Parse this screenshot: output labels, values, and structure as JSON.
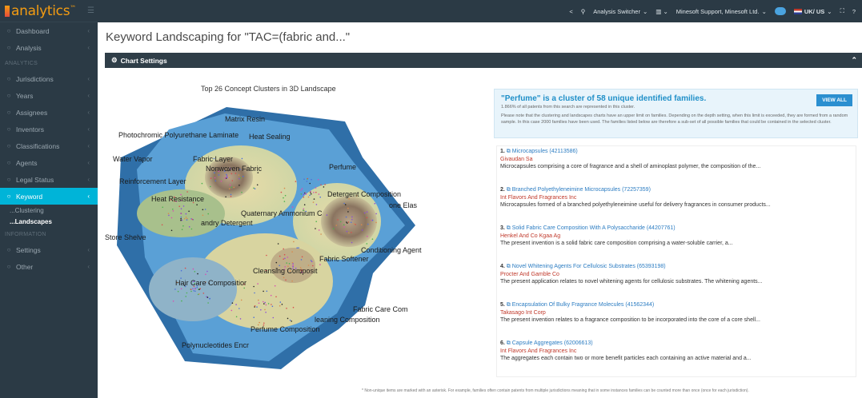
{
  "app": {
    "logo": "analytics",
    "logo_sup": "™"
  },
  "topbar": {
    "analysis_switcher": "Analysis Switcher",
    "org": "Minesoft Support, Minesoft Ltd.",
    "locale": "UK/ US"
  },
  "sidebar": {
    "items_top": [
      {
        "label": "Dashboard",
        "icon": "dashboard-icon"
      },
      {
        "label": "Analysis",
        "icon": "chart-icon"
      }
    ],
    "section_analytics": "ANALYTICS",
    "items_analytics": [
      {
        "label": "Jurisdictions",
        "icon": "globe-icon"
      },
      {
        "label": "Years",
        "icon": "calendar-icon"
      },
      {
        "label": "Assignees",
        "icon": "building-icon"
      },
      {
        "label": "Inventors",
        "icon": "person-icon"
      },
      {
        "label": "Classifications",
        "icon": "tag-icon"
      },
      {
        "label": "Agents",
        "icon": "briefcase-icon"
      },
      {
        "label": "Legal Status",
        "icon": "gavel-icon"
      },
      {
        "label": "Keyword",
        "icon": "key-icon",
        "active": true
      }
    ],
    "sub_items": [
      {
        "label": "...Clustering"
      },
      {
        "label": "...Landscapes",
        "current": true
      }
    ],
    "section_information": "INFORMATION",
    "items_info": [
      {
        "label": "Settings",
        "icon": "gear-icon"
      },
      {
        "label": "Other",
        "icon": "info-icon"
      }
    ]
  },
  "main": {
    "title": "Keyword Landscaping for \"TAC=(fabric and...\"",
    "settings_label": "Chart Settings",
    "chart_title": "Top 26 Concept Clusters in 3D Landscape",
    "labels": [
      "Matrix Resin",
      "Photochromic Polyurethane Laminate",
      "Heat Sealing",
      "Water Vapor",
      "Fabric Layer",
      "Nonwoven Fabric",
      "Perfume",
      "Reinforcement Layer",
      "Heat Resistance",
      "Detergent Composition",
      "one Elas",
      "Quaternary Ammonium C",
      "andry Detergent",
      "Store Shelve",
      "Conditioning Agent",
      "Fabric Softener",
      "Cleansing Composit",
      "Hair Care Compositior",
      "Fabric Care Com",
      "leaning Composition",
      "Perfume Composition",
      "Polynucleotides Encr"
    ],
    "footnote": "* Non-unique items are marked with an asterisk. For example, families often contain patents from multiple jurisdictions meaning that in some instances families can be counted more than once (once for each jurisdiction)."
  },
  "panel": {
    "title": "\"Perfume\" is a cluster of 58 unique identified families.",
    "subtitle": "1.866% of all patents from this search are represented in this cluster.",
    "note": "Please note that the clustering and landscapes charts have an upper limit on families. Depending on the depth setting, when this limit is exceeded, they are formed from a random sample. In this case 2000 families have been used. The families listed below are therefore a sub-set of all possible families that could be contained in the selected cluster.",
    "view_all": "VIEW ALL",
    "results": [
      {
        "num": "1.",
        "title": "Microcapsules (42113586)",
        "assignee": "Givaudan Sa",
        "desc": "Microcapsules comprising a core of fragrance and a shell of aminoplast polymer, the composition of the..."
      },
      {
        "num": "2.",
        "title": "Branched Polyethyleneimine Microcapsules (72257359)",
        "assignee": "Int Flavors And Fragrances Inc",
        "desc": "Microcapsules formed of a branched polyethyleneimine useful for delivery fragrances in consumer products..."
      },
      {
        "num": "3.",
        "title": "Solid Fabric Care Composition With A Polysaccharide (44207761)",
        "assignee": "Henkel And Co Kgaa Ag",
        "desc": "The present invention is a solid fabric care composition comprising a water-soluble carrier, a..."
      },
      {
        "num": "4.",
        "title": "Novel Whitening Agents For Cellulosic Substrates (65393198)",
        "assignee": "Procter And Gamble Co",
        "desc": "The present application relates to novel whitening agents for cellulosic substrates. The whitening agents..."
      },
      {
        "num": "5.",
        "title": "Encapsulation Of Bulky Fragrance Molecules (41562344)",
        "assignee": "Takasago Int Corp",
        "desc": "The present invention relates to a fragrance composition to be incorporated into the core of a core shell..."
      },
      {
        "num": "6.",
        "title": "Capsule Aggregates (62006613)",
        "assignee": "Int Flavors And Fragrances Inc",
        "desc": "The aggregates each contain two or more benefit particles each containing an active material and a..."
      }
    ]
  }
}
